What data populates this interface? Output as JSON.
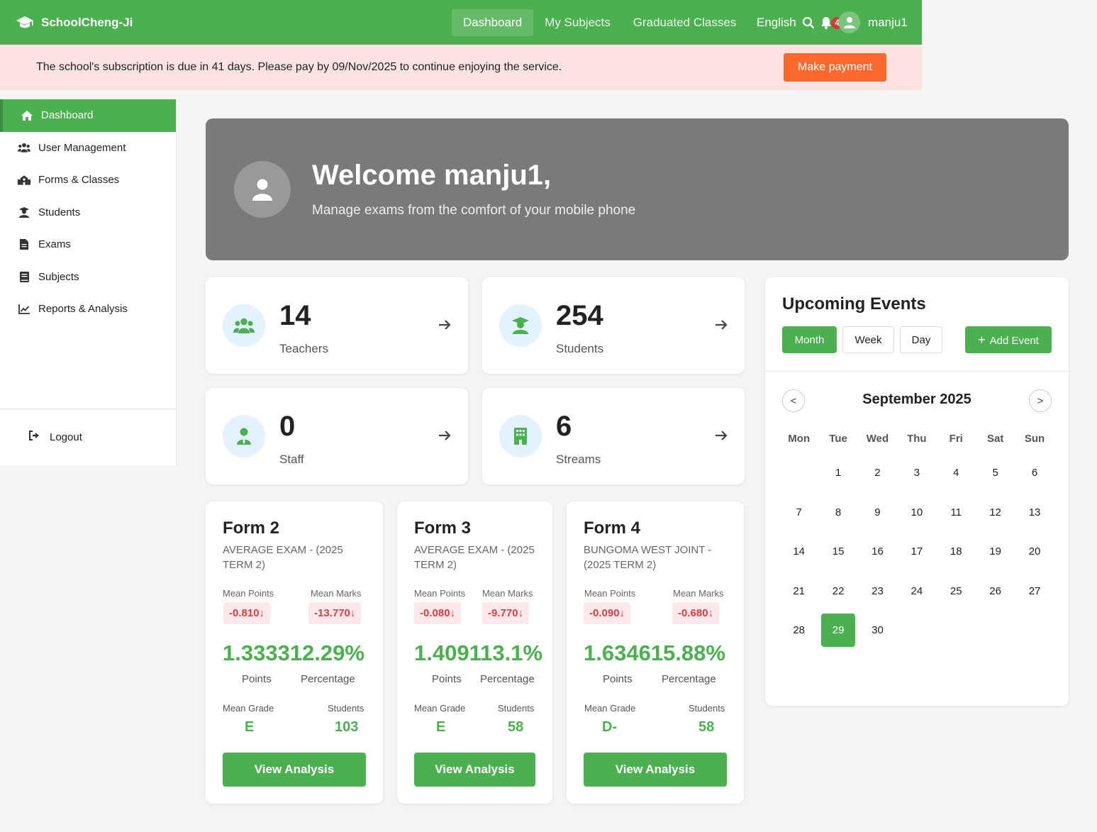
{
  "app": {
    "brand": "SchoolCheng-Ji",
    "accent": "#4caf50"
  },
  "nav": {
    "links": [
      "Dashboard",
      "My Subjects",
      "Graduated Classes"
    ],
    "language": "English",
    "notification_count": "4",
    "username": "manju1"
  },
  "alert": {
    "text": "The school's subscription is due in 41 days. Please pay by 09/Nov/2025 to continue enjoying the service.",
    "button": "Make payment"
  },
  "sidebar": {
    "items": [
      {
        "label": "Dashboard",
        "icon": "home-icon"
      },
      {
        "label": "User Management",
        "icon": "users-icon"
      },
      {
        "label": "Forms & Classes",
        "icon": "school-icon"
      },
      {
        "label": "Students",
        "icon": "student-icon"
      },
      {
        "label": "Exams",
        "icon": "file-icon"
      },
      {
        "label": "Subjects",
        "icon": "book-icon"
      },
      {
        "label": "Reports & Analysis",
        "icon": "chart-line-icon"
      }
    ],
    "logout": "Logout"
  },
  "welcome": {
    "title": "Welcome manju1,",
    "subtitle": "Manage exams from the comfort of your mobile phone"
  },
  "stats": [
    {
      "value": "14",
      "label": "Teachers",
      "icon": "users-icon"
    },
    {
      "value": "254",
      "label": "Students",
      "icon": "student-icon"
    },
    {
      "value": "0",
      "label": "Staff",
      "icon": "staff-icon"
    },
    {
      "value": "6",
      "label": "Streams",
      "icon": "building-icon"
    }
  ],
  "forms": [
    {
      "title": "Form 2",
      "exam": "AVERAGE EXAM - (2025 TERM 2)",
      "mean_points_label": "Mean Points",
      "mean_marks_label": "Mean Marks",
      "mean_points_delta": "-0.810↓",
      "mean_marks_delta": "-13.770↓",
      "big": "1.333312.29%",
      "points_label": "Points",
      "percentage_label": "Percentage",
      "grade_label": "Mean Grade",
      "students_label": "Students",
      "grade": "E",
      "students": "103",
      "button": "View Analysis"
    },
    {
      "title": "Form 3",
      "exam": "AVERAGE EXAM - (2025 TERM 2)",
      "mean_points_label": "Mean Points",
      "mean_marks_label": "Mean Marks",
      "mean_points_delta": "-0.080↓",
      "mean_marks_delta": "-9.770↓",
      "big": "1.409113.1%",
      "points_label": "Points",
      "percentage_label": "Percentage",
      "grade_label": "Mean Grade",
      "students_label": "Students",
      "grade": "E",
      "students": "58",
      "button": "View Analysis"
    },
    {
      "title": "Form 4",
      "exam": "BUNGOMA WEST JOINT - (2025 TERM 2)",
      "mean_points_label": "Mean Points",
      "mean_marks_label": "Mean Marks",
      "mean_points_delta": "-0.090↓",
      "mean_marks_delta": "-0.680↓",
      "big": "1.634615.88%",
      "points_label": "Points",
      "percentage_label": "Percentage",
      "grade_label": "Mean Grade",
      "students_label": "Students",
      "grade": "D-",
      "students": "58",
      "button": "View Analysis"
    }
  ],
  "events": {
    "title": "Upcoming Events",
    "views": [
      "Month",
      "Week",
      "Day"
    ],
    "active_view": "Month",
    "add_button": "Add Event",
    "prev": "<",
    "next": ">",
    "month": "September 2025",
    "weekdays": [
      "Mon",
      "Tue",
      "Wed",
      "Thu",
      "Fri",
      "Sat",
      "Sun"
    ],
    "weeks": [
      [
        "",
        "1",
        "2",
        "3",
        "4",
        "5",
        "6"
      ],
      [
        "7",
        "8",
        "9",
        "10",
        "11",
        "12",
        "13"
      ],
      [
        "14",
        "15",
        "16",
        "17",
        "18",
        "19",
        "20"
      ],
      [
        "21",
        "22",
        "23",
        "24",
        "25",
        "26",
        "27"
      ],
      [
        "28",
        "29",
        "30",
        "",
        "",
        "",
        ""
      ]
    ],
    "today": "29"
  }
}
